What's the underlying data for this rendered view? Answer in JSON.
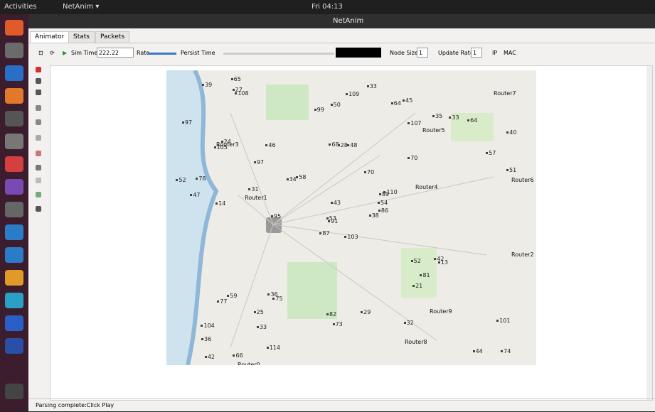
{
  "topbar": {
    "activities": "Activities",
    "app": "NetAnim ▾",
    "time": "Fri 04:13"
  },
  "window": {
    "title": "NetAnim"
  },
  "tabs": [
    "Animator",
    "Stats",
    "Packets"
  ],
  "toolbar": {
    "sim_time_label": "Sim Time",
    "sim_time": "222.22",
    "rate_label": "Rate",
    "persist_label": "Persist Time",
    "speed_label": "Node Size",
    "node_size": "1",
    "update_rate_label": "Update Rate",
    "update_rate": "1",
    "ip_label": "IP",
    "mac_label": "MAC"
  },
  "status": {
    "message": "Parsing complete:Click Play"
  },
  "map": {
    "routers": [
      "Router3",
      "Router1",
      "Router4",
      "Router6",
      "Router5",
      "Router2",
      "Router0",
      "Router8",
      "Router9",
      "Router7"
    ],
    "nodes": [
      "103",
      "105",
      "91",
      "104",
      "89",
      "75",
      "45",
      "48",
      "107",
      "38",
      "108",
      "74",
      "14",
      "40",
      "87",
      "70",
      "66",
      "68",
      "70",
      "59",
      "58",
      "36",
      "33",
      "28",
      "110",
      "13",
      "24",
      "50",
      "47",
      "52",
      "51",
      "53",
      "82",
      "43",
      "46",
      "35",
      "36",
      "44",
      "101",
      "42",
      "33",
      "34",
      "31",
      "21",
      "114",
      "52",
      "54",
      "42",
      "73",
      "86",
      "77",
      "57",
      "97",
      "81",
      "32",
      "25",
      "27",
      "39",
      "29",
      "64",
      "109",
      "95",
      "78",
      "97",
      "33",
      "65",
      "64",
      "99"
    ]
  }
}
